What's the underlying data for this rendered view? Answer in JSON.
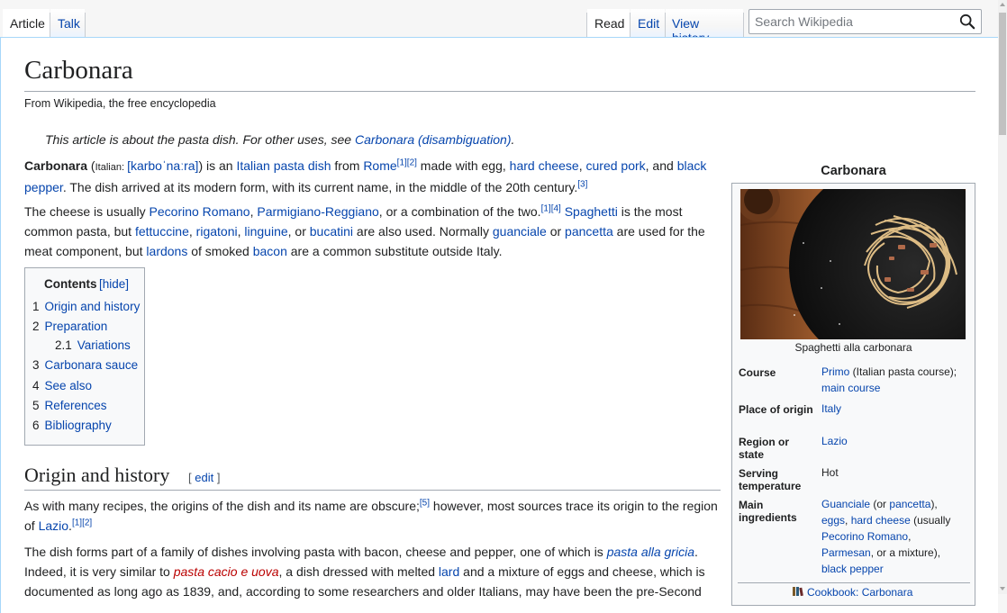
{
  "tabs": {
    "article": "Article",
    "talk": "Talk",
    "read": "Read",
    "edit": "Edit",
    "history": "View history"
  },
  "search": {
    "placeholder": "Search Wikipedia"
  },
  "article": {
    "title": "Carbonara",
    "tagline": "From Wikipedia, the free encyclopedia",
    "hatnote": {
      "prefix": "This article is about the pasta dish. For other uses, see ",
      "link": "Carbonara (disambiguation)",
      "suffix": "."
    },
    "intro1": {
      "bold": "Carbonara",
      "ipa_label": "Italian: ",
      "ipa": "[karboˈnaːra]",
      "t1": ") is an ",
      "l1": "Italian pasta dish",
      "t2": " from ",
      "l2": "Rome",
      "r1": "[1]",
      "r2": "[2]",
      "t3": " made with egg, ",
      "l3": "hard cheese",
      "t4": ", ",
      "l4": "cured pork",
      "t5": ", and ",
      "l5": "black pepper",
      "t6": ". The dish arrived at its modern form, with its current name, in the middle of the 20th century.",
      "r3": "[3]"
    },
    "intro2": {
      "t1": "The cheese is usually ",
      "l1": "Pecorino Romano",
      "t2": ", ",
      "l2": "Parmigiano-Reggiano",
      "t3": ", or a combination of the two.",
      "r1": "[1]",
      "r4": "[4]",
      "l3": "Spaghetti",
      "t4": " is the most common pasta, but ",
      "l4": "fettuccine",
      "t5": ", ",
      "l5": "rigatoni",
      "t6": ", ",
      "l6": "linguine",
      "t7": ", or ",
      "l7": "bucatini",
      "t8": " are also used. Normally ",
      "l8": "guanciale",
      "t9": " or ",
      "l9": "pancetta",
      "t10": " are used for the meat component, but ",
      "l10": "lardons",
      "t11": " of smoked ",
      "l11": "bacon",
      "t12": " are a common substitute outside Italy."
    },
    "toc": {
      "title": "Contents",
      "hide": "[hide]",
      "items": [
        {
          "num": "1",
          "label": "Origin and history"
        },
        {
          "num": "2",
          "label": "Preparation"
        },
        {
          "num": "2.1",
          "label": "Variations"
        },
        {
          "num": "3",
          "label": "Carbonara sauce"
        },
        {
          "num": "4",
          "label": "See also"
        },
        {
          "num": "5",
          "label": "References"
        },
        {
          "num": "6",
          "label": "Bibliography"
        }
      ]
    },
    "section1": {
      "title": "Origin and history",
      "edit": "edit"
    },
    "p3": {
      "t1": "As with many recipes, the origins of the dish and its name are obscure;",
      "r5": "[5]",
      "t2": " however, most sources trace its origin to the region of ",
      "l1": "Lazio",
      "t3": ".",
      "r1": "[1]",
      "r2": "[2]"
    },
    "p4": {
      "t1": "The dish forms part of a family of dishes involving pasta with bacon, cheese and pepper, one of which is ",
      "l1": "pasta alla gricia",
      "t2": ". Indeed, it is very similar to ",
      "l2": "pasta cacio e uova",
      "t3": ", a dish dressed with melted ",
      "l3": "lard",
      "t4": " and a mixture of eggs and cheese, which is documented as long ago as 1839, and, according to some researchers and older Italians, may have been the pre-Second"
    }
  },
  "infobox": {
    "title": "Carbonara",
    "caption": "Spaghetti alla carbonara",
    "rows": {
      "course_label": "Course",
      "course_l1": "Primo",
      "course_t1": " (Italian pasta course);",
      "course_l2": "main course",
      "origin_label": "Place of origin",
      "origin_val": "Italy",
      "region_label": "Region or state",
      "region_val": "Lazio",
      "temp_label": "Serving temperature",
      "temp_val": "Hot",
      "ingr_label": "Main ingredients",
      "ingr_l1": "Guanciale",
      "ingr_t1": " (or ",
      "ingr_l2": "pancetta",
      "ingr_t2": "),",
      "ingr_l3": "eggs",
      "ingr_t3": ", ",
      "ingr_l4": "hard cheese",
      "ingr_t4": " (usually",
      "ingr_l5": "Pecorino Romano",
      "ingr_t5": ",",
      "ingr_l6": "Parmesan",
      "ingr_t6": ", or a mixture),",
      "ingr_l7": "black pepper"
    },
    "cookbook": "Cookbook: Carbonara"
  },
  "colors": {
    "link": "#0645ad",
    "redlink": "#ba0000",
    "border": "#a2a9b1"
  }
}
